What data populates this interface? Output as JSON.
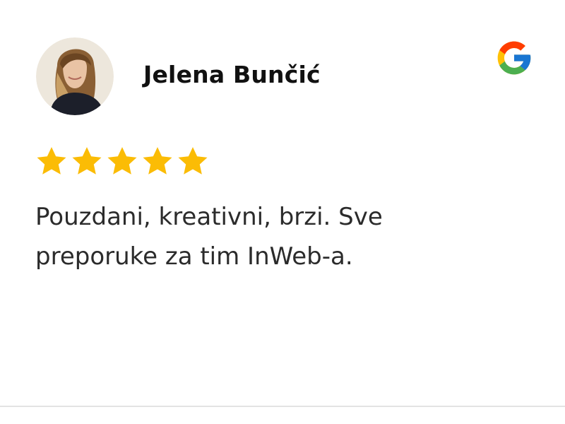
{
  "review": {
    "reviewer_name": "Jelena Bunčić",
    "avatar": "reviewer-avatar-photo",
    "source_icon": "google-logo-icon",
    "rating": 5,
    "rating_max": 5,
    "star_color": "#FBBC05",
    "text_lines": [
      "Pouzdani, kreativni, brzi. Sve",
      "preporuke za tim InWeb-a."
    ]
  }
}
